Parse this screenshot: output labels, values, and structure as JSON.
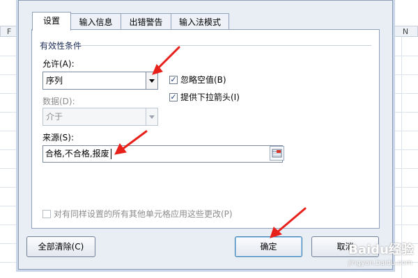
{
  "sheet": {
    "columns": [
      "F",
      "N"
    ]
  },
  "dialog": {
    "tabs": [
      {
        "label": "设置",
        "active": true
      },
      {
        "label": "输入信息",
        "active": false
      },
      {
        "label": "出错警告",
        "active": false
      },
      {
        "label": "输入法模式",
        "active": false
      }
    ],
    "group_title": "有效性条件",
    "allow": {
      "label": "允许(A):",
      "value": "序列"
    },
    "ignore_blank": {
      "label": "忽略空值(B)",
      "checked": true
    },
    "dropdown_arrow": {
      "label": "提供下拉箭头(I)",
      "checked": true
    },
    "data": {
      "label": "数据(D):",
      "value": "介于"
    },
    "source": {
      "label": "来源(S):",
      "value": "合格,不合格,报废"
    },
    "apply_all": {
      "label": "对有同样设置的所有其他单元格应用这些更改(P)",
      "checked": false
    },
    "buttons": {
      "clear_all": "全部清除(C)",
      "ok": "确定",
      "cancel": "取消"
    }
  },
  "icons": {
    "check": "check-icon",
    "dropdown": "chevron-down-icon",
    "range_select": "range-select-icon",
    "annotation_arrow": "red-arrow-icon"
  },
  "colors": {
    "annotation_arrow": "#e8201a",
    "dialog_bg": "#e9eef5",
    "panel_border": "#8fa1ba",
    "default_button_border": "#3c7fb1"
  },
  "watermark": {
    "text": "Baidu经验",
    "sub": "jingyan.baidu.com"
  }
}
